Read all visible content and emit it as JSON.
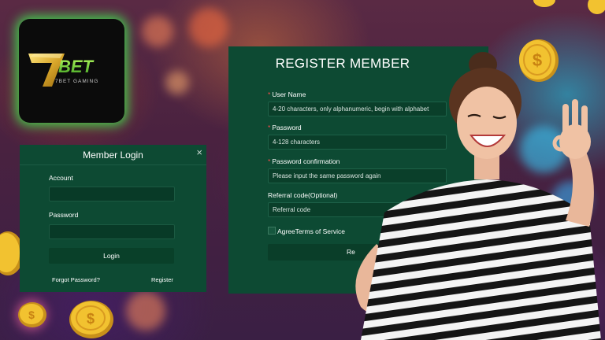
{
  "brand": {
    "logo_mark": "7BET",
    "logo_sub": "7BET GAMING",
    "glow_color": "#3cff50"
  },
  "login": {
    "title": "Member Login",
    "close_icon": "×",
    "account_label": "Account",
    "account_value": "",
    "password_label": "Password",
    "password_value": "",
    "login_button": "Login",
    "forgot_link": "Forgot Password?",
    "register_link": "Register"
  },
  "register": {
    "title": "REGISTER MEMBER",
    "required_mark": "*",
    "username_label": "User Name",
    "username_placeholder": "4-20 characters, only alphanumeric, begin with alphabet",
    "password_label": "Password",
    "password_placeholder": "4-128 characters",
    "confirm_label": "Password confirmation",
    "confirm_placeholder": "Please input the same password again",
    "referral_label": "Referral code(Optional)",
    "referral_placeholder": "Referral code",
    "agree_text": "AgreeTerms of Service",
    "register_button": "Re"
  },
  "colors": {
    "panel": "#0d4a33",
    "field": "#0a3f2a",
    "asterisk": "#ff4b4b",
    "coin": "#f2c230"
  },
  "icons": {
    "coin_symbol": "$"
  }
}
